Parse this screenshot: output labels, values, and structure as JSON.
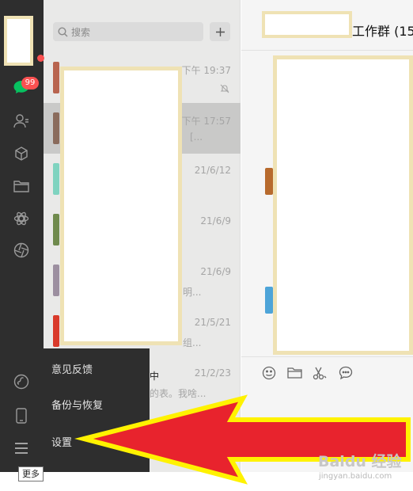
{
  "nav": {
    "unread_badge": "99",
    "icons": [
      "chat-icon",
      "contacts-icon",
      "favorites-icon",
      "files-icon",
      "moments-icon",
      "channels-icon",
      "miniprogram-icon",
      "phone-icon",
      "menu-icon"
    ]
  },
  "search": {
    "placeholder": "搜索"
  },
  "chat_list": {
    "items": [
      {
        "time": "下午 19:37",
        "subtitle": ""
      },
      {
        "time": "下午 17:57",
        "subtitle": "[..."
      },
      {
        "time": "21/6/12",
        "subtitle": ""
      },
      {
        "time": "21/6/9",
        "subtitle": ""
      },
      {
        "time": "21/6/9",
        "subtitle": "明..."
      },
      {
        "time": "21/5/21",
        "subtitle": "组..."
      },
      {
        "time": "21/2/23",
        "subtitle": "的表。我啥..."
      }
    ],
    "peek_name": "中"
  },
  "more_menu": {
    "items": [
      "意见反馈",
      "备份与恢复",
      "设置"
    ]
  },
  "tooltip": "更多",
  "chat": {
    "title": "工作群 (15"
  },
  "watermark": {
    "brand": "Baidu 经验",
    "url": "jingyan.baidu.com"
  },
  "colors": {
    "nav_bg": "#2e2e2e",
    "list_bg": "#e9e9e8",
    "selected": "#c9c9c8",
    "badge": "#fa5151",
    "arrow_fill": "#e8232d",
    "arrow_border": "#fff200",
    "redaction_border": "#efe2b4"
  }
}
